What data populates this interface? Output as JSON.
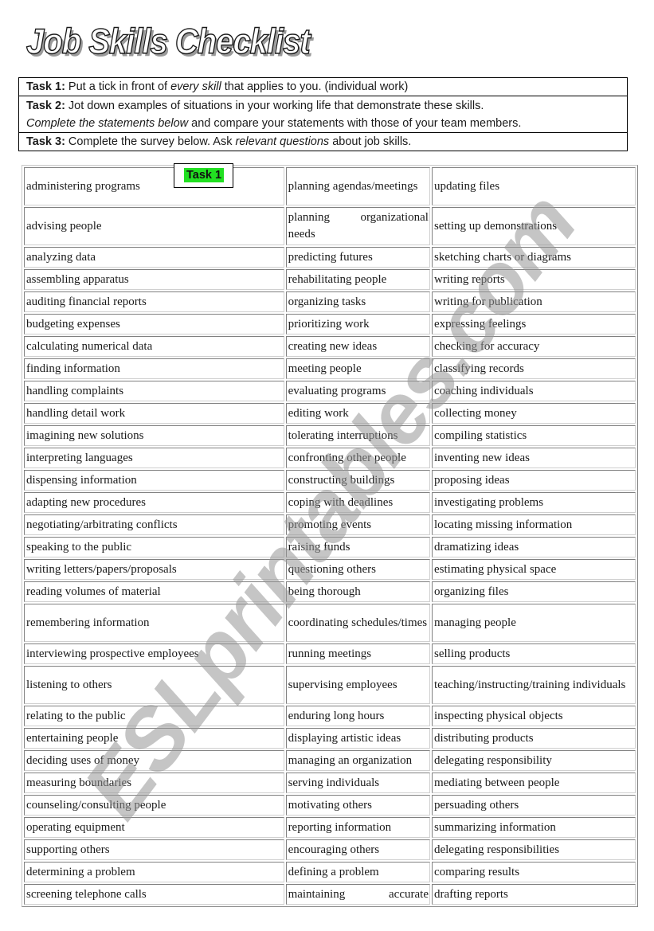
{
  "title": "Job Skills Checklist",
  "tasks": [
    {
      "label": "Task 1:",
      "text_parts": [
        " Put a tick in front of ",
        "every skill",
        " that applies to you. (individual work)"
      ]
    },
    {
      "label": "Task 2:",
      "text_parts": [
        " Jot down examples of situations in your working life that demonstrate these skills."
      ],
      "line2_parts": [
        "Complete the statements below",
        " and compare your statements with those of your team members."
      ]
    },
    {
      "label": "Task 3:",
      "text_parts": [
        " Complete the survey below. Ask ",
        "relevant questions",
        " about job skills."
      ]
    }
  ],
  "task_badge": {
    "label": "Task 1",
    "color": "#22e022"
  },
  "watermark": "ESLprintables.com",
  "skills_table": {
    "rows": [
      [
        "administering programs",
        "planning agendas/meetings",
        "updating files"
      ],
      [
        "advising people",
        "planning organizational needs",
        "setting up demonstrations"
      ],
      [
        "analyzing data",
        "predicting futures",
        "sketching charts or diagrams"
      ],
      [
        "assembling apparatus",
        "rehabilitating people",
        "writing reports"
      ],
      [
        "auditing financial reports",
        "organizing tasks",
        "writing for publication"
      ],
      [
        "budgeting expenses",
        "prioritizing work",
        "expressing feelings"
      ],
      [
        "calculating numerical data",
        "creating new ideas",
        "checking for accuracy"
      ],
      [
        "finding information",
        "meeting people",
        "classifying records"
      ],
      [
        "handling complaints",
        "evaluating programs",
        "coaching individuals"
      ],
      [
        "handling detail work",
        "editing work",
        "collecting money"
      ],
      [
        "imagining new solutions",
        "tolerating interruptions",
        "compiling statistics"
      ],
      [
        "interpreting languages",
        "confronting other people",
        "inventing new ideas"
      ],
      [
        "dispensing information",
        "constructing buildings",
        "proposing ideas"
      ],
      [
        "adapting new procedures",
        "coping with deadlines",
        "investigating problems"
      ],
      [
        "negotiating/arbitrating conflicts",
        "promoting events",
        "locating missing information"
      ],
      [
        "speaking to the public",
        "raising funds",
        "dramatizing ideas"
      ],
      [
        "writing letters/papers/proposals",
        "questioning others",
        "estimating physical space"
      ],
      [
        "reading volumes of material",
        "being thorough",
        "organizing files"
      ],
      [
        "remembering information",
        "coordinating schedules/times",
        "managing people"
      ],
      [
        "interviewing prospective employees",
        "running meetings",
        "selling products"
      ],
      [
        "listening to others",
        "supervising employees",
        "teaching/instructing/training individuals"
      ],
      [
        "relating to the public",
        "enduring long hours",
        "inspecting physical objects"
      ],
      [
        "entertaining people",
        "displaying artistic ideas",
        "distributing products"
      ],
      [
        "deciding uses of money",
        "managing an organization",
        "delegating responsibility"
      ],
      [
        "measuring boundaries",
        "serving individuals",
        "mediating between people"
      ],
      [
        "counseling/consulting people",
        "motivating others",
        "persuading others"
      ],
      [
        "operating equipment",
        "reporting information",
        "summarizing information"
      ],
      [
        "supporting others",
        "encouraging others",
        "delegating responsibilities"
      ],
      [
        "determining a problem",
        "defining a problem",
        "comparing results"
      ],
      [
        "screening telephone calls",
        "maintaining accurate",
        "drafting reports"
      ]
    ]
  }
}
